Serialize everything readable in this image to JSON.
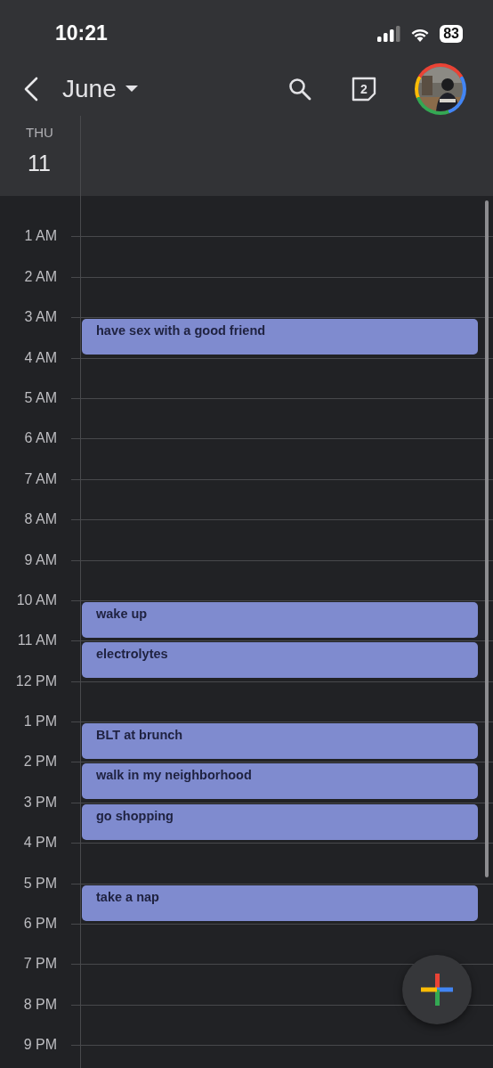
{
  "status_bar": {
    "time": "10:21",
    "battery": "83"
  },
  "toolbar": {
    "month": "June",
    "tasks_count": "2"
  },
  "day_header": {
    "weekday": "THU",
    "date": "11"
  },
  "hours": [
    {
      "label": "1 AM"
    },
    {
      "label": "2 AM"
    },
    {
      "label": "3 AM",
      "event": {
        "title": "have sex with a good friend"
      }
    },
    {
      "label": "4 AM"
    },
    {
      "label": "5 AM"
    },
    {
      "label": "6 AM"
    },
    {
      "label": "7 AM"
    },
    {
      "label": "8 AM"
    },
    {
      "label": "9 AM"
    },
    {
      "label": "10 AM",
      "event": {
        "title": "wake up"
      }
    },
    {
      "label": "11 AM",
      "event": {
        "title": "electrolytes"
      }
    },
    {
      "label": "12 PM"
    },
    {
      "label": "1 PM",
      "event": {
        "title": "BLT at brunch"
      }
    },
    {
      "label": "2 PM",
      "event": {
        "title": "walk in my neighborhood"
      }
    },
    {
      "label": "3 PM",
      "event": {
        "title": "go shopping"
      }
    },
    {
      "label": "4 PM"
    },
    {
      "label": "5 PM",
      "event": {
        "title": "take a nap"
      }
    },
    {
      "label": "6 PM"
    },
    {
      "label": "7 PM"
    },
    {
      "label": "8 PM"
    },
    {
      "label": "9 PM"
    }
  ]
}
